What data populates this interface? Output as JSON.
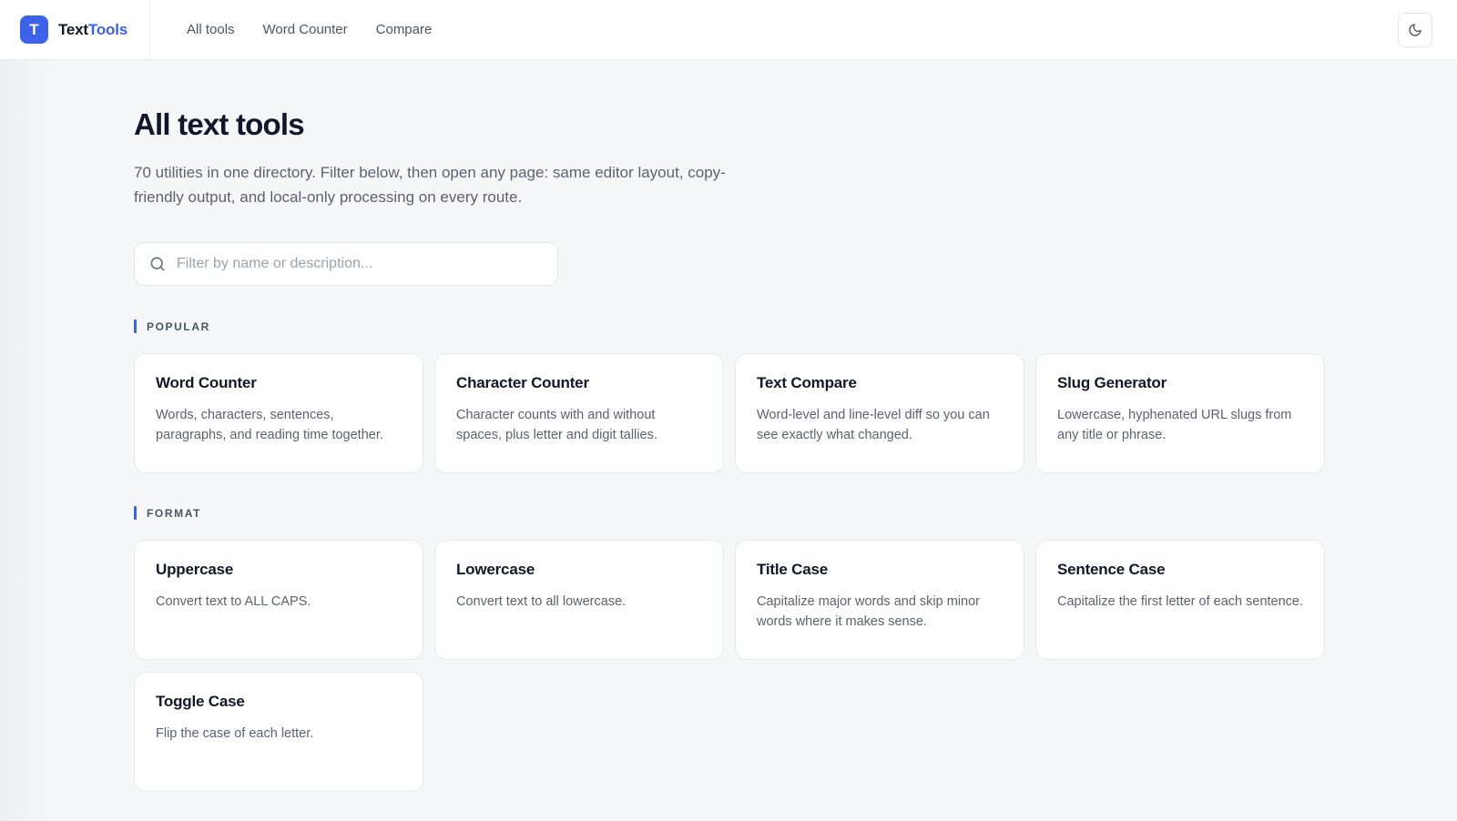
{
  "header": {
    "brand": {
      "logo_letter": "T",
      "name_part1": "Text",
      "name_part2": "Tools"
    },
    "nav": [
      {
        "label": "All tools"
      },
      {
        "label": "Word Counter"
      },
      {
        "label": "Compare"
      }
    ],
    "theme_toggle_icon": "moon-icon"
  },
  "main": {
    "title": "All text tools",
    "intro": "70 utilities in one directory. Filter below, then open any page: same editor layout, copy-friendly output, and local-only processing on every route.",
    "search": {
      "value": "",
      "placeholder": "Filter by name or description...",
      "icon": "search-icon"
    },
    "sections": [
      {
        "label": "POPULAR",
        "tools": [
          {
            "title": "Word Counter",
            "description": "Words, characters, sentences, paragraphs, and reading time together."
          },
          {
            "title": "Character Counter",
            "description": "Character counts with and without spaces, plus letter and digit tallies."
          },
          {
            "title": "Text Compare",
            "description": "Word-level and line-level diff so you can see exactly what changed."
          },
          {
            "title": "Slug Generator",
            "description": "Lowercase, hyphenated URL slugs from any title or phrase."
          }
        ]
      },
      {
        "label": "FORMAT",
        "tools": [
          {
            "title": "Uppercase",
            "description": "Convert text to ALL CAPS."
          },
          {
            "title": "Lowercase",
            "description": "Convert text to all lowercase."
          },
          {
            "title": "Title Case",
            "description": "Capitalize major words and skip minor words where it makes sense."
          },
          {
            "title": "Sentence Case",
            "description": "Capitalize the first letter of each sentence."
          },
          {
            "title": "Toggle Case",
            "description": "Flip the case of each letter."
          }
        ]
      }
    ]
  },
  "colors": {
    "accent": "#3b62e8",
    "background": "#f6f7f9",
    "card": "#ffffff",
    "text_primary": "#111827",
    "text_secondary": "#5b6270"
  }
}
